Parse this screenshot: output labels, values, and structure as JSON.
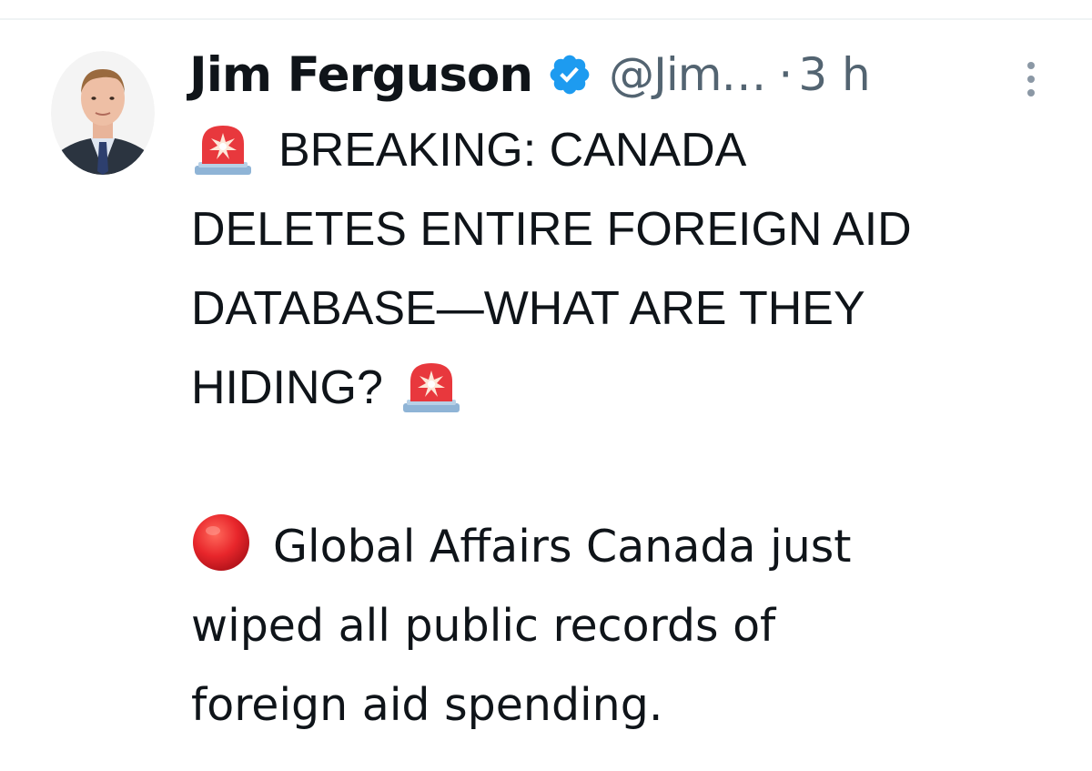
{
  "tweet": {
    "author": {
      "display_name": "Jim Ferguson",
      "handle": "@Jim…",
      "verified": true,
      "avatar": "profile-photo"
    },
    "separator": "·",
    "timestamp": "3 h",
    "more_icon": "more-vertical-icon",
    "body": {
      "paragraph_1": {
        "lead_emoji": "police-siren-emoji",
        "lines": [
          "BREAKING: CANADA",
          "DELETES ENTIRE FOREIGN AID",
          "DATABASE—WHAT ARE THEY",
          "HIDING?"
        ],
        "trail_emoji": "police-siren-emoji"
      },
      "paragraph_2": {
        "lead_emoji": "red-circle-emoji",
        "lines": [
          "Global Affairs Canada just",
          "wiped all public records of",
          "foreign aid spending."
        ]
      }
    },
    "colors": {
      "text": "#0f1419",
      "secondary_text": "#536471",
      "verified_badge": "#1d9bf0",
      "divider": "#eff3f4"
    }
  }
}
